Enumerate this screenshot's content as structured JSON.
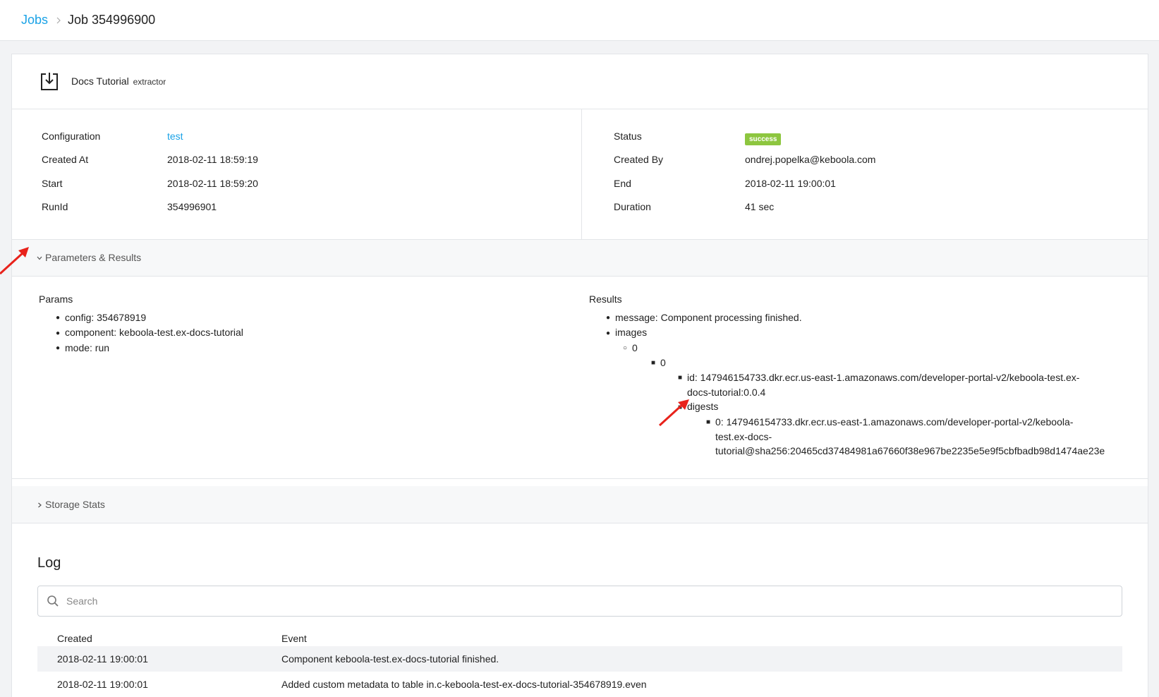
{
  "breadcrumb": {
    "jobs_label": "Jobs",
    "current_label": "Job 354996900"
  },
  "component": {
    "name": "Docs Tutorial",
    "type": "extractor",
    "icon": "extractor-download-icon"
  },
  "details": {
    "left": [
      {
        "label": "Configuration",
        "value": "test",
        "is_link": true
      },
      {
        "label": "Created At",
        "value": "2018-02-11 18:59:19"
      },
      {
        "label": "Start",
        "value": "2018-02-11 18:59:20"
      },
      {
        "label": "RunId",
        "value": "354996901"
      }
    ],
    "right": [
      {
        "label": "Status",
        "value": "success",
        "is_badge": true
      },
      {
        "label": "Created By",
        "value": "ondrej.popelka@keboola.com"
      },
      {
        "label": "End",
        "value": "2018-02-11 19:00:01"
      },
      {
        "label": "Duration",
        "value": "41 sec"
      }
    ]
  },
  "params_results": {
    "section_title": "Parameters & Results",
    "params_title": "Params",
    "params": [
      "config: 354678919",
      "component: keboola-test.ex-docs-tutorial",
      "mode: run"
    ],
    "results_title": "Results",
    "results": {
      "message": "message: Component processing finished.",
      "images": "images",
      "level1": "0",
      "level2": "0",
      "id_line1": "id: 147946154733.dkr.ecr.us-east-1.amazonaws.com/developer-portal-v2/keboola-test.ex-",
      "id_line2": "docs-tutorial:0.0.4",
      "digests": "digests",
      "digest_line1": "0: 147946154733.dkr.ecr.us-east-1.amazonaws.com/developer-portal-v2/keboola-",
      "digest_line2": "test.ex-docs-",
      "digest_line3": "tutorial@sha256:20465cd37484981a67660f38e967be2235e5e9f5cbfbadb98d1474ae23e"
    }
  },
  "storage_stats": {
    "section_title": "Storage Stats"
  },
  "log": {
    "title": "Log",
    "search_placeholder": "Search",
    "columns": {
      "created": "Created",
      "event": "Event"
    },
    "rows": [
      {
        "created": "2018-02-11 19:00:01",
        "event": "Component keboola-test.ex-docs-tutorial finished."
      },
      {
        "created": "2018-02-11 19:00:01",
        "event": "Added custom metadata to table in.c-keboola-test-ex-docs-tutorial-354678919.even"
      }
    ]
  },
  "colors": {
    "link": "#1aa2e6",
    "success": "#8dc63f",
    "annotation_arrow": "#e8221b"
  }
}
